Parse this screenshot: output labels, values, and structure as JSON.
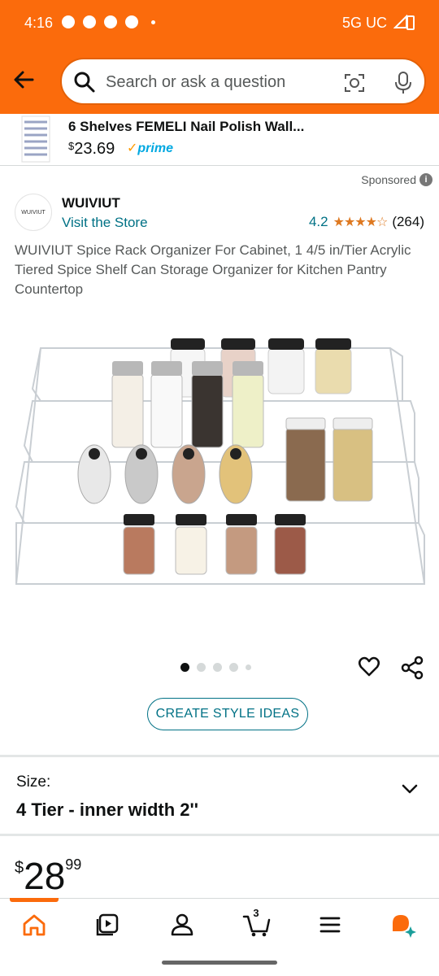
{
  "status_bar": {
    "time": "4:16",
    "network": "5G UC"
  },
  "search": {
    "placeholder": "Search or ask a question"
  },
  "ad": {
    "title": "6 Shelves FEMELI Nail Polish Wall...",
    "price_symbol": "$",
    "price": "23.69",
    "prime_label": "prime"
  },
  "sponsored_label": "Sponsored",
  "brand": {
    "logo_text": "WUIVIUT",
    "name": "WUIVIUT",
    "visit_label": "Visit the Store",
    "rating": "4.2",
    "stars": 4.2,
    "review_count": "(264)"
  },
  "product": {
    "title": "WUIVIUT Spice Rack Organizer For Cabinet, 1 4/5 in/Tier Acrylic Tiered Spice Shelf Can Storage Organizer for Kitchen Pantry Countertop",
    "image_count": 5,
    "current_image_index": 0
  },
  "style_ideas_label": "CREATE STYLE IDEAS",
  "size": {
    "label": "Size:",
    "value": "4 Tier - inner width 2''"
  },
  "price": {
    "symbol": "$",
    "whole": "28",
    "fraction": "99"
  },
  "bottom_nav": {
    "tabs": [
      "home-icon",
      "video-icon",
      "account-icon",
      "cart-icon",
      "menu-icon",
      "rufus-icon"
    ],
    "cart_count": "3",
    "active_tab": "home"
  },
  "colors": {
    "brand_orange": "#fb6b0c",
    "link_teal": "#007185",
    "star_orange": "#de7921",
    "prime_blue": "#00a8e1"
  }
}
